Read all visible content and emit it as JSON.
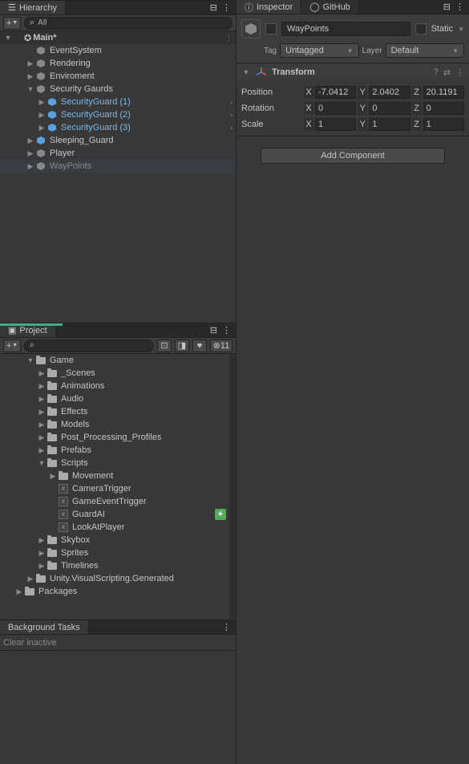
{
  "hierarchy": {
    "tab": "Hierarchy",
    "search_placeholder": "All",
    "root": "Main*",
    "items": [
      {
        "label": "EventSystem",
        "icon": "cube",
        "indent": 2
      },
      {
        "label": "Rendering",
        "icon": "cube",
        "indent": 2,
        "arrow": "right"
      },
      {
        "label": "Enviroment",
        "icon": "cube",
        "indent": 2,
        "arrow": "right"
      },
      {
        "label": "Security Gaurds",
        "icon": "cube",
        "indent": 2,
        "arrow": "down"
      },
      {
        "label": "SecurityGuard (1)",
        "icon": "cube-blue",
        "indent": 3,
        "arrow": "right",
        "blue": true,
        "end": true
      },
      {
        "label": "SecurityGuard (2)",
        "icon": "cube-blue",
        "indent": 3,
        "arrow": "right",
        "blue": true,
        "end": true
      },
      {
        "label": "SecurityGuard (3)",
        "icon": "cube-blue",
        "indent": 3,
        "arrow": "right",
        "blue": true,
        "end": true
      },
      {
        "label": "Sleeping_Guard",
        "icon": "cube-blue",
        "indent": 2,
        "arrow": "right"
      },
      {
        "label": "Player",
        "icon": "cube",
        "indent": 2,
        "arrow": "right"
      },
      {
        "label": "WayPoints",
        "icon": "cube",
        "indent": 2,
        "arrow": "right",
        "dim": true,
        "selected": true
      }
    ]
  },
  "project": {
    "tab": "Project",
    "count": "11",
    "items": [
      {
        "label": "Game",
        "icon": "folder",
        "indent": 2,
        "arrow": "down"
      },
      {
        "label": "_Scenes",
        "icon": "folder",
        "indent": 3,
        "arrow": "right"
      },
      {
        "label": "Animations",
        "icon": "folder",
        "indent": 3,
        "arrow": "right"
      },
      {
        "label": "Audio",
        "icon": "folder",
        "indent": 3,
        "arrow": "right"
      },
      {
        "label": "Effects",
        "icon": "folder",
        "indent": 3,
        "arrow": "right"
      },
      {
        "label": "Models",
        "icon": "folder",
        "indent": 3,
        "arrow": "right"
      },
      {
        "label": "Post_Processing_Profiles",
        "icon": "folder",
        "indent": 3,
        "arrow": "right"
      },
      {
        "label": "Prefabs",
        "icon": "folder",
        "indent": 3,
        "arrow": "right"
      },
      {
        "label": "Scripts",
        "icon": "folder",
        "indent": 3,
        "arrow": "down"
      },
      {
        "label": "Movement",
        "icon": "folder",
        "indent": 4,
        "arrow": "right"
      },
      {
        "label": "CameraTrigger",
        "icon": "cs",
        "indent": 4
      },
      {
        "label": "GameEventTrigger",
        "icon": "cs",
        "indent": 4
      },
      {
        "label": "GuardAI",
        "icon": "cs",
        "indent": 4,
        "plus": true
      },
      {
        "label": "LookAtPlayer",
        "icon": "cs",
        "indent": 4
      },
      {
        "label": "Skybox",
        "icon": "folder",
        "indent": 3,
        "arrow": "right"
      },
      {
        "label": "Sprites",
        "icon": "folder",
        "indent": 3,
        "arrow": "right"
      },
      {
        "label": "Timelines",
        "icon": "folder",
        "indent": 3,
        "arrow": "right"
      },
      {
        "label": "Unity.VisualScripting.Generated",
        "icon": "folder",
        "indent": 2,
        "arrow": "right"
      },
      {
        "label": "Packages",
        "icon": "folder",
        "indent": 1,
        "arrow": "right"
      }
    ]
  },
  "tasks": {
    "tab": "Background Tasks",
    "clear": "Clear inactive"
  },
  "inspector": {
    "tab": "Inspector",
    "github_tab": "GitHub",
    "object_name": "WayPoints",
    "static_label": "Static",
    "tag_label": "Tag",
    "tag_value": "Untagged",
    "layer_label": "Layer",
    "layer_value": "Default",
    "transform": {
      "title": "Transform",
      "position": {
        "label": "Position",
        "x": "-7.0412",
        "y": "2.0402",
        "z": "20.1191"
      },
      "rotation": {
        "label": "Rotation",
        "x": "0",
        "y": "0",
        "z": "0"
      },
      "scale": {
        "label": "Scale",
        "x": "1",
        "y": "1",
        "z": "1"
      }
    },
    "add_component": "Add Component"
  }
}
